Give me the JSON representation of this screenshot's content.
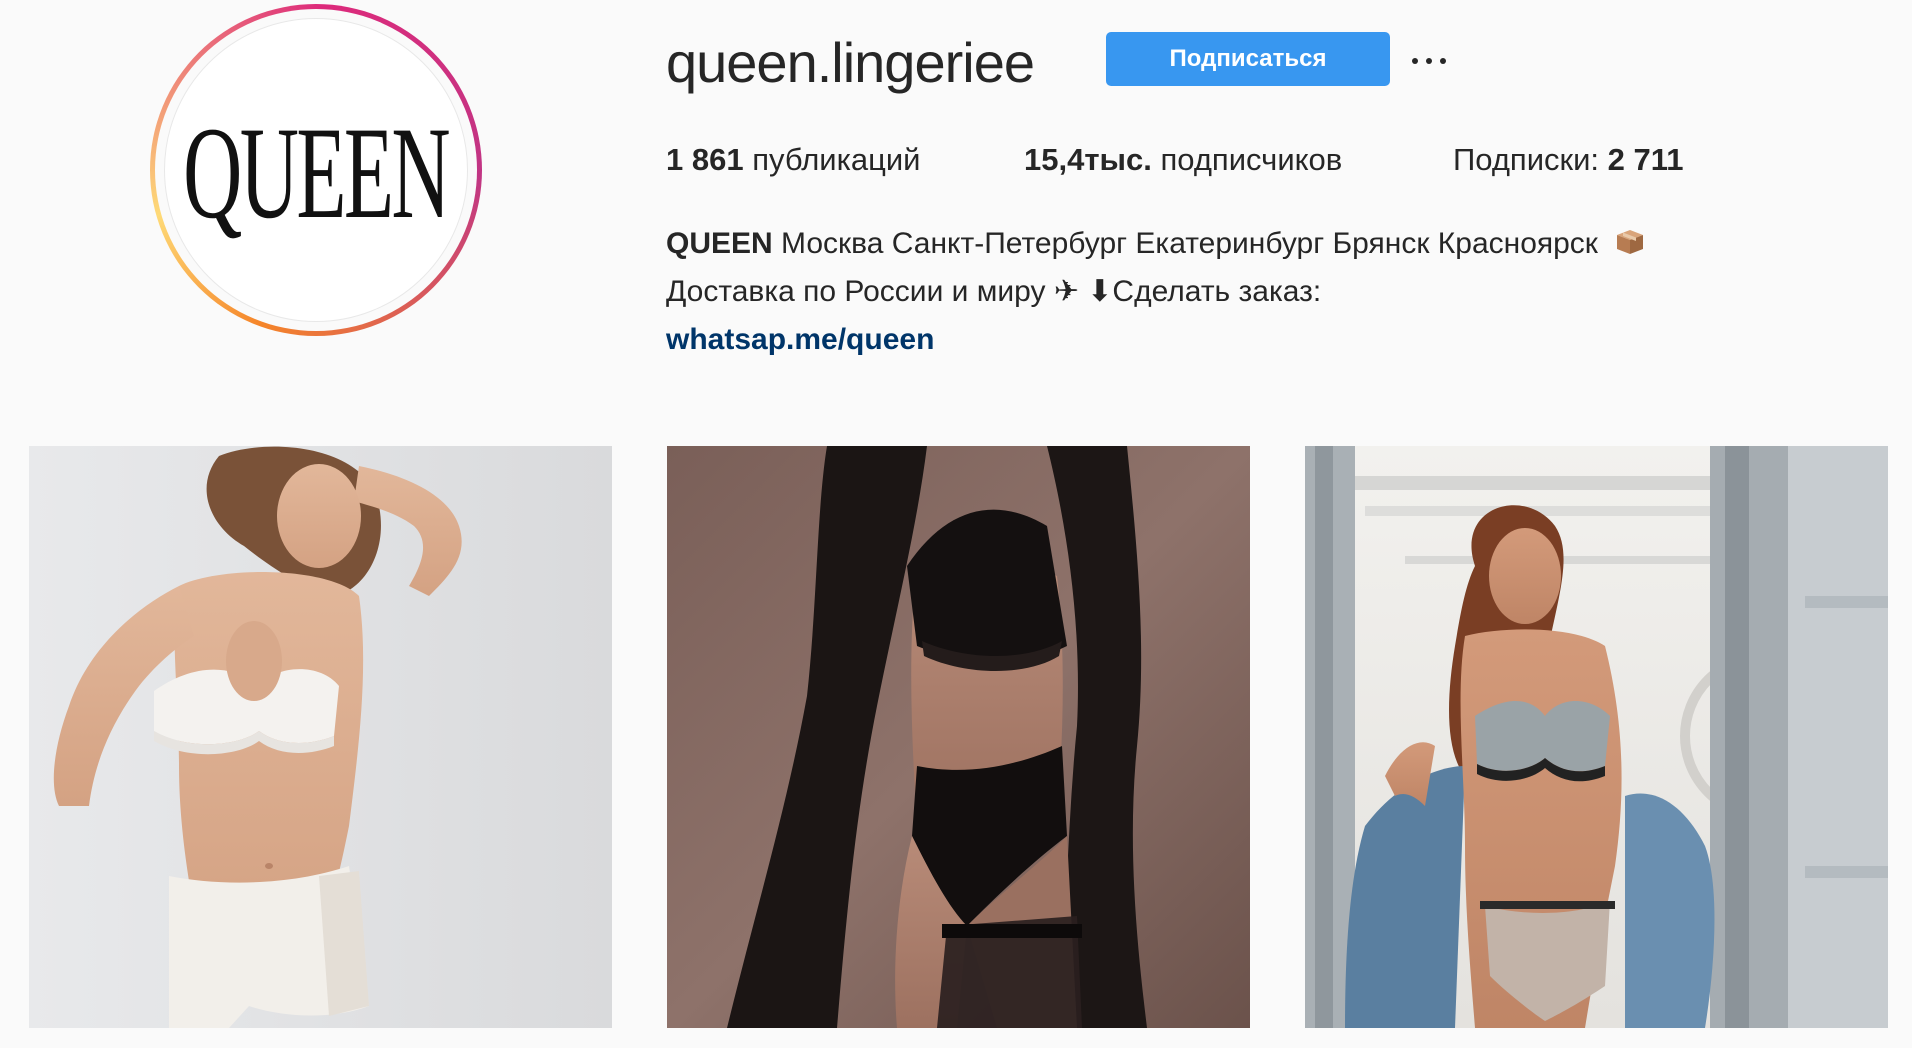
{
  "profile": {
    "avatar_text": "QUEEN",
    "username": "queen.lingeriee",
    "follow_label": "Подписаться",
    "more_icon": "more-options-icon"
  },
  "stats": {
    "posts_count": "1 861",
    "posts_label": "публикаций",
    "followers_count": "15,4тыс.",
    "followers_label": "подписчиков",
    "following_label": "Подписки:",
    "following_count": "2 711"
  },
  "bio": {
    "name": "QUEEN",
    "line1_text": "Москва Санкт-Петербург Екатеринбург Брянск Красноярск",
    "line1_icon": "package-icon",
    "line2_text": "Доставка по России и миру ✈ ⬇Сделать заказ:",
    "link": "whatsap.me/queen"
  },
  "colors": {
    "follow_button": "#3897f0",
    "link": "#003569",
    "text": "#262626",
    "background": "#fafafa"
  },
  "posts": [
    {
      "description_icon": "photo-white-lingerie"
    },
    {
      "description_icon": "photo-black-lingerie"
    },
    {
      "description_icon": "photo-grey-lingerie-denim"
    }
  ]
}
